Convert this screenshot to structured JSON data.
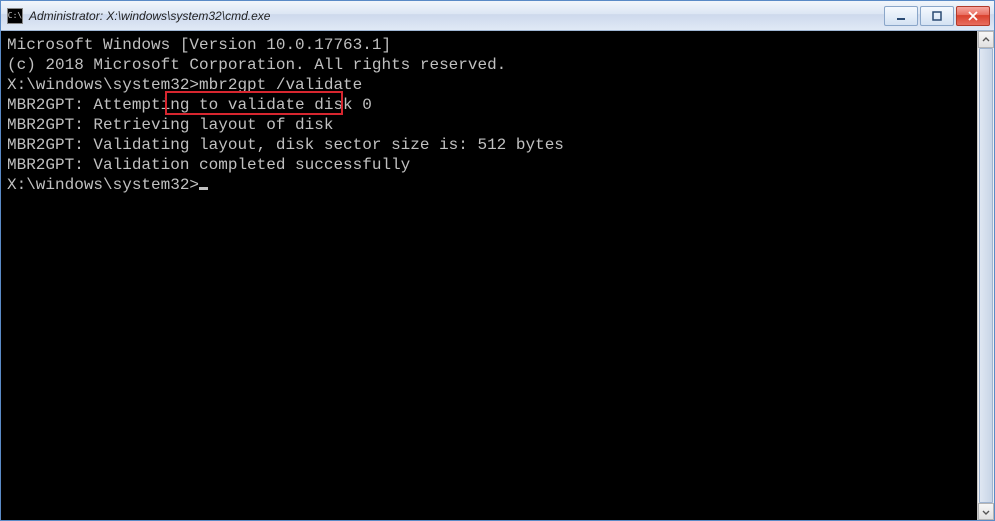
{
  "window": {
    "title": "Administrator: X:\\windows\\system32\\cmd.exe",
    "icon_label": "C:\\"
  },
  "terminal": {
    "lines": [
      "Microsoft Windows [Version 10.0.17763.1]",
      "(c) 2018 Microsoft Corporation. All rights reserved.",
      "",
      "X:\\windows\\system32>mbr2gpt /validate",
      "MBR2GPT: Attempting to validate disk 0",
      "MBR2GPT: Retrieving layout of disk",
      "MBR2GPT: Validating layout, disk sector size is: 512 bytes",
      "MBR2GPT: Validation completed successfully",
      "",
      "X:\\windows\\system32>"
    ],
    "prompt1_left": "X:\\windows\\system32>",
    "prompt1_cmd": "mbr2gpt /validate",
    "prompt2": "X:\\windows\\system32>"
  },
  "highlight": {
    "command": "mbr2gpt /validate"
  }
}
